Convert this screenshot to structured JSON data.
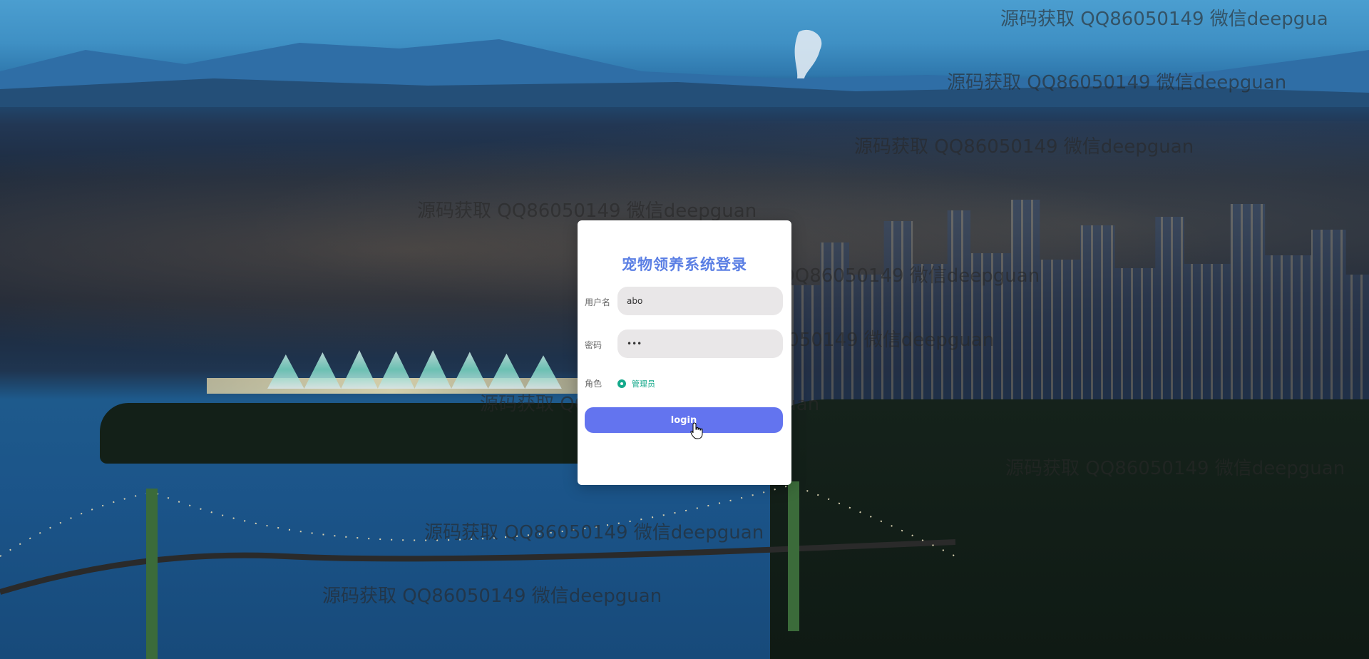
{
  "background": {
    "description_colors": {
      "sky": "#4b9ed0",
      "water": "#1e5a8c",
      "forest": "#132018"
    }
  },
  "watermarks": [
    "源码获取 QQ86050149 微信deepgua",
    "源码获取 QQ86050149 微信deepguan",
    "源码获取 QQ86050149 微信deepguan",
    "源码获取 QQ86050149 微信deepguan",
    "源码获取 QQ86050149 微信deepguan",
    "源码获取 QQ86050149 微信deepguan",
    "源码获取 QQ86050149 微信deepguan",
    "源码获取 QQ86050149 微信deepguan",
    "源码获取 QQ86050149 微信deepguan",
    "源码获取 QQ86050149 微信deepguan"
  ],
  "login": {
    "title": "宠物领养系统登录",
    "username_label": "用户名",
    "username_value": "abo",
    "password_label": "密码",
    "password_value": "abc",
    "role_label": "角色",
    "role_option": "管理员",
    "role_selected": true,
    "button_label": "login",
    "accent_color": "#6374ef",
    "title_color": "#5b7fe4",
    "radio_color": "#15a98b"
  }
}
